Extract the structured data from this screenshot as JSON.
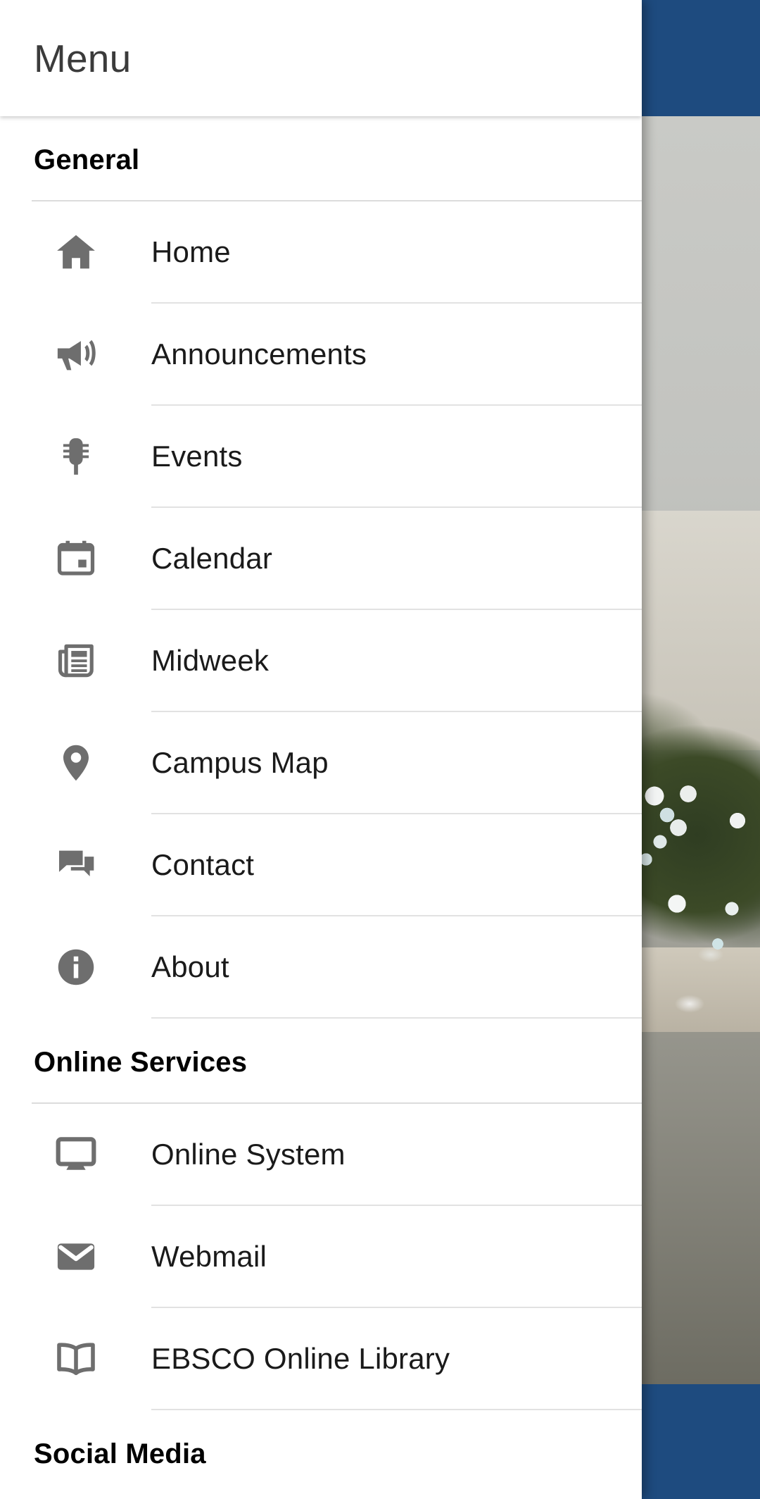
{
  "background": {
    "appbar_color": "#1e4b7f",
    "bottombar_color": "#1e4b7f",
    "photo_description": "aerial-campus-street-photo"
  },
  "drawer": {
    "title": "Menu",
    "background_color": "#ffffff",
    "text_color": "#1a1a1a",
    "divider_color": "#e2e2e2",
    "icon_color": "#6e6e6e",
    "sections": [
      {
        "heading": "General",
        "items": [
          {
            "label": "Home",
            "icon": "home-icon"
          },
          {
            "label": "Announcements",
            "icon": "bullhorn-icon"
          },
          {
            "label": "Events",
            "icon": "microphone-icon"
          },
          {
            "label": "Calendar",
            "icon": "calendar-icon"
          },
          {
            "label": "Midweek",
            "icon": "newspaper-icon"
          },
          {
            "label": "Campus Map",
            "icon": "map-pin-icon"
          },
          {
            "label": "Contact",
            "icon": "chat-bubbles-icon"
          },
          {
            "label": "About",
            "icon": "info-circle-icon"
          }
        ]
      },
      {
        "heading": "Online Services",
        "items": [
          {
            "label": "Online System",
            "icon": "desktop-monitor-icon"
          },
          {
            "label": "Webmail",
            "icon": "envelope-icon"
          },
          {
            "label": "EBSCO Online Library",
            "icon": "open-book-icon"
          }
        ]
      },
      {
        "heading": "Social Media",
        "items": []
      }
    ]
  }
}
